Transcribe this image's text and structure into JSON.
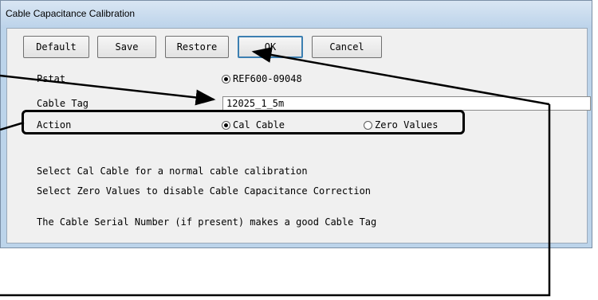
{
  "window": {
    "title": "Cable Capacitance Calibration"
  },
  "toolbar": {
    "default_label": "Default",
    "save_label": "Save",
    "restore_label": "Restore",
    "ok_label": "OK",
    "cancel_label": "Cancel"
  },
  "fields": {
    "pstat": {
      "label": "Pstat",
      "option": "REF600-09048",
      "selected": true
    },
    "cable_tag": {
      "label": "Cable Tag",
      "value": "12025_1_5m"
    },
    "action": {
      "label": "Action",
      "options": [
        {
          "label": "Cal Cable",
          "selected": true
        },
        {
          "label": "Zero Values",
          "selected": false
        }
      ]
    }
  },
  "help": {
    "line1": "Select Cal Cable for a normal cable calibration",
    "line2": "Select Zero Values to disable Cable Capacitance Correction",
    "line3": "The Cable Serial Number (if present) makes a good Cable Tag"
  }
}
